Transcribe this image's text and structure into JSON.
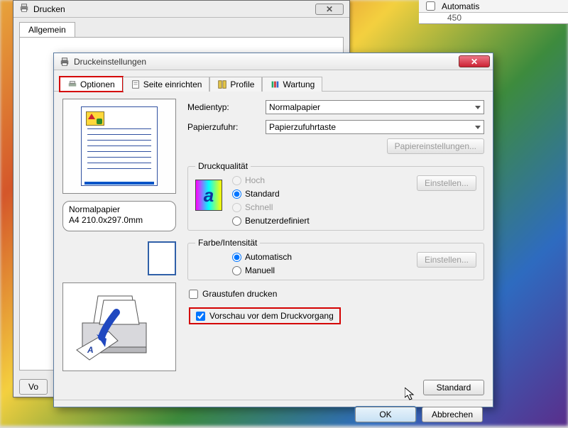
{
  "outer": {
    "title": "Drucken",
    "tab": "Allgemein",
    "truncated_button": "Vo"
  },
  "topbar": {
    "automatic": "Automatis"
  },
  "ruler": {
    "mark": "450"
  },
  "dialog": {
    "title": "Druckeinstellungen",
    "tabs": [
      "Optionen",
      "Seite einrichten",
      "Profile",
      "Wartung"
    ],
    "paper_name": "Normalpapier",
    "paper_size": "A4 210.0x297.0mm",
    "media_label": "Medientyp:",
    "media_value": "Normalpapier",
    "source_label": "Papierzufuhr:",
    "source_value": "Papierzufuhrtaste",
    "paper_settings_btn": "Papiereinstellungen...",
    "quality_legend": "Druckqualität",
    "q_high": "Hoch",
    "q_std": "Standard",
    "q_fast": "Schnell",
    "q_user": "Benutzerdefiniert",
    "einstellen": "Einstellen...",
    "color_legend": "Farbe/Intensität",
    "c_auto": "Automatisch",
    "c_manual": "Manuell",
    "grayscale": "Graustufen drucken",
    "preview_chk": "Vorschau vor dem Druckvorgang",
    "standard_btn": "Standard",
    "ok": "OK",
    "cancel": "Abbrechen"
  }
}
